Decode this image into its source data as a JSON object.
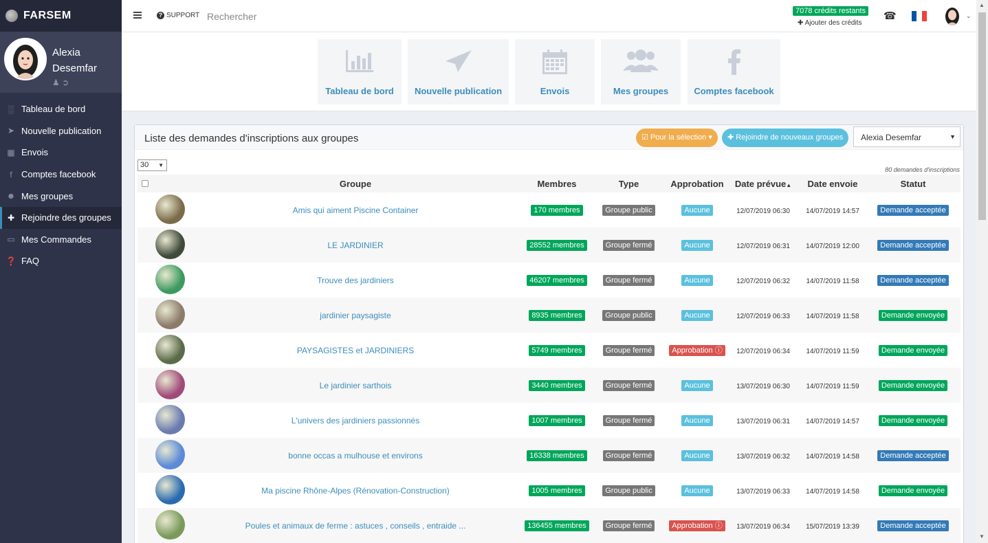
{
  "brand": {
    "name": "FARSEM"
  },
  "user": {
    "first": "Alexia",
    "last": "Desemfar"
  },
  "sidebar": {
    "items": [
      {
        "label": "Tableau de bord",
        "icon": "bar-chart-icon"
      },
      {
        "label": "Nouvelle publication",
        "icon": "paper-plane-icon"
      },
      {
        "label": "Envois",
        "icon": "calendar-icon"
      },
      {
        "label": "Comptes facebook",
        "icon": "facebook-icon"
      },
      {
        "label": "Mes groupes",
        "icon": "group-icon"
      },
      {
        "label": "Rejoindre des groupes",
        "icon": "plus-icon"
      },
      {
        "label": "Mes Commandes",
        "icon": "orders-icon"
      },
      {
        "label": "FAQ",
        "icon": "question-icon"
      }
    ]
  },
  "topbar": {
    "support": "SUPPORT",
    "search_placeholder": "Rechercher",
    "credits": "7078 crédits restants",
    "add_credits": "Ajouter des crédits"
  },
  "shortcuts": [
    {
      "label": "Tableau de bord",
      "icon": "bar-chart-icon"
    },
    {
      "label": "Nouvelle publication",
      "icon": "paper-plane-icon"
    },
    {
      "label": "Envois",
      "icon": "calendar-icon"
    },
    {
      "label": "Mes groupes",
      "icon": "group-icon"
    },
    {
      "label": "Comptes facebook",
      "icon": "facebook-icon"
    }
  ],
  "panel": {
    "title": "Liste des demandes d'inscriptions aux groupes",
    "selection_button": "Pour la sélection",
    "join_button": "Rejoindre de nouveaux groupes",
    "account": "Alexia Desemfar",
    "page_size": "30",
    "count": "80 demandes d'inscriptions"
  },
  "table": {
    "headers": [
      "Groupe",
      "Membres",
      "Type",
      "Approbation",
      "Date prévue",
      "Date envoie",
      "Statut"
    ],
    "rows": [
      {
        "group": "Amis qui aiment Piscine Container",
        "members": "170 membres",
        "type": "Groupe public",
        "approval": "Aucune",
        "planned": "12/07/2019 06:30",
        "sent": "14/07/2019 14:57",
        "status": "Demande acceptée",
        "thumb": "#7b6b4a"
      },
      {
        "group": "LE JARDINIER",
        "members": "28552 membres",
        "type": "Groupe fermé",
        "approval": "Aucune",
        "planned": "12/07/2019 06:31",
        "sent": "14/07/2019 12:00",
        "status": "Demande acceptée",
        "thumb": "#3f4a3a"
      },
      {
        "group": "Trouve des jardiniers",
        "members": "46207 membres",
        "type": "Groupe fermé",
        "approval": "Aucune",
        "planned": "12/07/2019 06:32",
        "sent": "14/07/2019 11:58",
        "status": "Demande acceptée",
        "thumb": "#3c9a5f"
      },
      {
        "group": "jardinier paysagiste",
        "members": "8935 membres",
        "type": "Groupe public",
        "approval": "Aucune",
        "planned": "12/07/2019 06:33",
        "sent": "14/07/2019 11:58",
        "status": "Demande envoyée",
        "thumb": "#8b7b6a"
      },
      {
        "group": "PAYSAGISTES et JARDINIERS",
        "members": "5749 membres",
        "type": "Groupe fermé",
        "approval": "Approbation",
        "planned": "12/07/2019 06:34",
        "sent": "14/07/2019 11:59",
        "status": "Demande envoyée",
        "thumb": "#5a6b4a"
      },
      {
        "group": "Le jardinier sarthois",
        "members": "3440 membres",
        "type": "Groupe fermé",
        "approval": "Aucune",
        "planned": "13/07/2019 06:30",
        "sent": "14/07/2019 11:59",
        "status": "Demande envoyée",
        "thumb": "#a04a7a"
      },
      {
        "group": "L'univers des jardiniers passionnés",
        "members": "1007 membres",
        "type": "Groupe fermé",
        "approval": "Aucune",
        "planned": "13/07/2019 06:31",
        "sent": "14/07/2019 14:57",
        "status": "Demande envoyée",
        "thumb": "#6a7bb0"
      },
      {
        "group": "bonne occas a mulhouse et environs",
        "members": "16338 membres",
        "type": "Groupe fermé",
        "approval": "Aucune",
        "planned": "13/07/2019 06:32",
        "sent": "14/07/2019 14:58",
        "status": "Demande acceptée",
        "thumb": "#5b8ad8"
      },
      {
        "group": "Ma piscine Rhône-Alpes (Rénovation-Construction)",
        "members": "1005 membres",
        "type": "Groupe public",
        "approval": "Aucune",
        "planned": "13/07/2019 06:33",
        "sent": "14/07/2019 14:58",
        "status": "Demande envoyée",
        "thumb": "#2a6bb0"
      },
      {
        "group": "Poules et animaux de ferme : astuces , conseils , entraide ...",
        "members": "136455 membres",
        "type": "Groupe fermé",
        "approval": "Approbation",
        "planned": "13/07/2019 06:34",
        "sent": "15/07/2019 13:39",
        "status": "Demande acceptée",
        "thumb": "#7a9a5a"
      }
    ]
  },
  "colors": {
    "sidebar": "#2f3349",
    "accent": "#3c8dbc",
    "success": "#00a65a",
    "warning": "#f0ad4e",
    "info": "#5bc0de",
    "danger": "#d9534f",
    "primary": "#337ab7"
  }
}
